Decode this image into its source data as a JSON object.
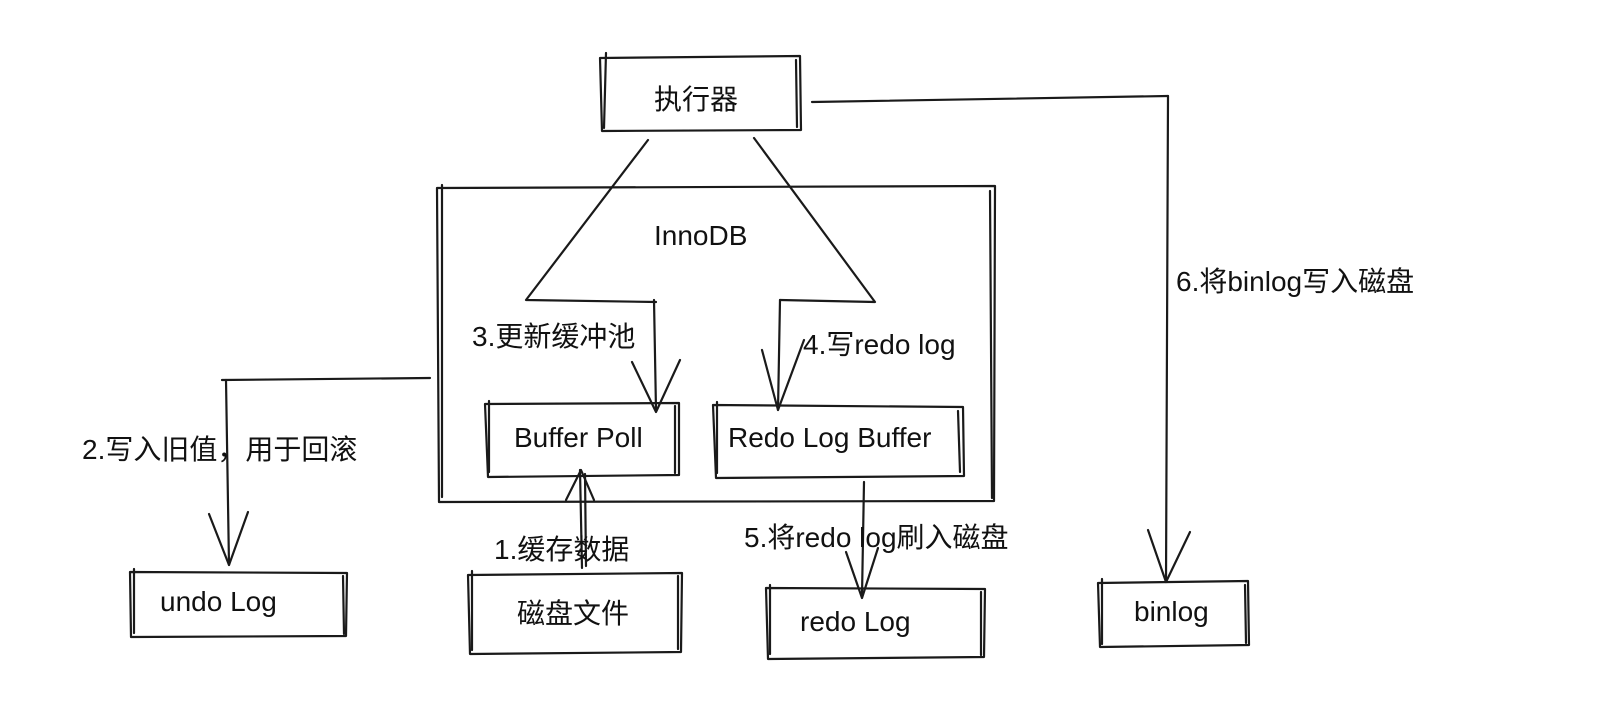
{
  "colors": {
    "stroke": "#1a1a1a",
    "background": "#ffffff",
    "text": "#111111"
  },
  "nodes": {
    "executor": "执行器",
    "innodb": "InnoDB",
    "buffer_pool": "Buffer Poll",
    "redo_log_buffer": "Redo Log Buffer",
    "undo_log": "undo Log",
    "disk_file": "磁盘文件",
    "redo_log": "redo Log",
    "binlog": "binlog"
  },
  "edges": {
    "step1": "1.缓存数据",
    "step2": "2.写入旧值，用于回滚",
    "step3": "3.更新缓冲池",
    "step4": "4.写redo log",
    "step5": "5.将redo log刷入磁盘",
    "step6": "6.将binlog写入磁盘"
  }
}
